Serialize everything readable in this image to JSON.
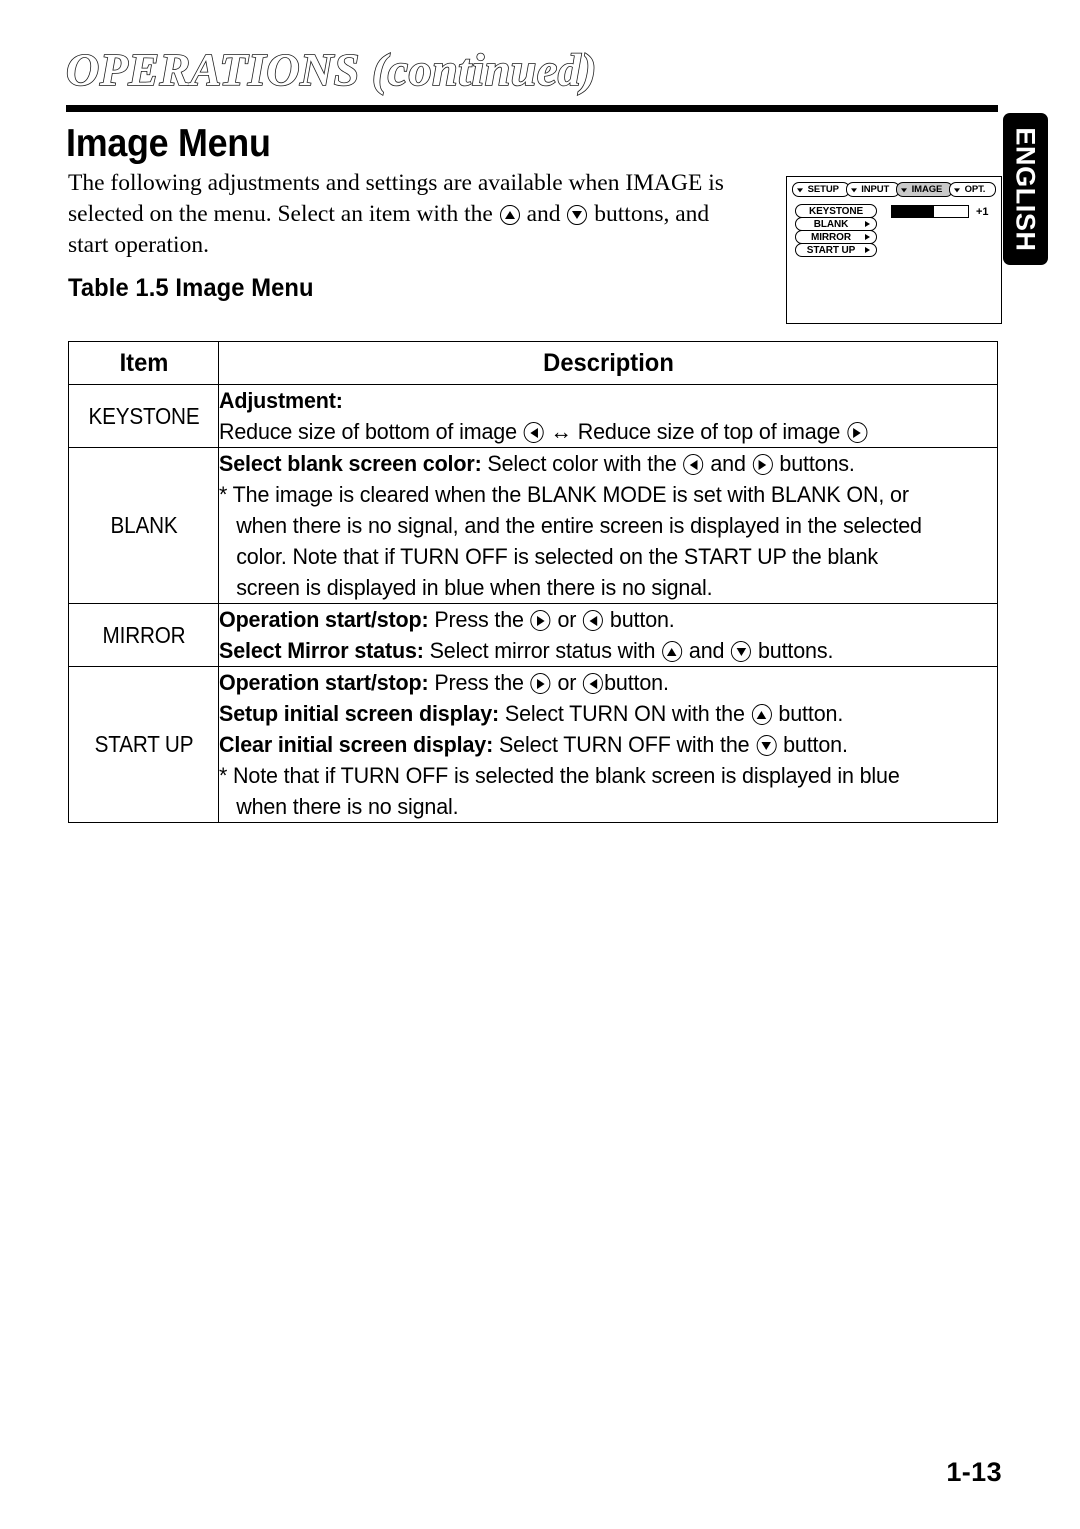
{
  "page": {
    "chapter_title": "OPERATIONS (continued)",
    "section_heading": "Image Menu",
    "page_number": "1-13",
    "language_tab": "ENGLISH"
  },
  "intro": {
    "line1": "The following adjustments and settings are available when IMAGE is",
    "line2a": "selected on the menu. Select an item with the",
    "line2b": "and",
    "line2c": "buttons, and",
    "line3": "start operation."
  },
  "table": {
    "caption": "Table 1.5 Image Menu",
    "headers": {
      "item": "Item",
      "description": "Description"
    },
    "rows": [
      {
        "item": "KEYSTONE",
        "lines": [
          {
            "bold": "Adjustment:"
          },
          {
            "text_a": "Reduce size of bottom of image",
            "icon_a": "left-arrow-button-icon",
            "mid": "↔",
            "text_b": "Reduce size of top of image",
            "icon_b": "right-arrow-button-icon"
          }
        ]
      },
      {
        "item": "BLANK",
        "lines": [
          {
            "bold": "Select blank screen color:",
            "text_a": "Select color with the",
            "icon_a": "left-arrow-button-icon",
            "mid": "and",
            "icon_b": "right-arrow-button-icon",
            "text_b": "buttons."
          },
          {
            "text": "* The image is cleared when the BLANK MODE is set with BLANK ON, or"
          },
          {
            "text": "when there is no signal, and the entire screen is displayed in the selected",
            "indent": true
          },
          {
            "text": "color. Note that if TURN OFF is selected on the START UP the blank",
            "indent": true
          },
          {
            "text": "screen is displayed in blue when there is no signal.",
            "indent": true
          }
        ]
      },
      {
        "item": "MIRROR",
        "lines": [
          {
            "bold": "Operation start/stop:",
            "text_a": "Press the",
            "icon_a": "right-arrow-button-icon",
            "mid": "or",
            "icon_b": "left-arrow-button-icon",
            "text_b": "button."
          },
          {
            "bold": "Select Mirror status:",
            "text_a": "Select mirror status with",
            "icon_a": "up-arrow-button-icon",
            "mid": "and",
            "icon_b": "down-arrow-button-icon",
            "text_b": "buttons."
          }
        ]
      },
      {
        "item": "START UP",
        "lines": [
          {
            "bold": "Operation start/stop:",
            "text_a": "Press the",
            "icon_a": "right-arrow-button-icon",
            "mid": "or",
            "icon_b": "left-arrow-button-icon",
            "text_b": "button."
          },
          {
            "bold": "Setup initial screen display:",
            "text_a": "Select TURN ON with the",
            "icon_a": "up-arrow-button-icon",
            "text_b": "button."
          },
          {
            "bold": "Clear initial screen display:",
            "text_a": "Select TURN OFF with the",
            "icon_a": "down-arrow-button-icon",
            "text_b": "button."
          },
          {
            "text": "* Note that if TURN OFF is selected the blank screen is displayed in blue"
          },
          {
            "text": "when there is no signal.",
            "indent": true
          }
        ]
      }
    ]
  },
  "osd": {
    "tabs": [
      {
        "label": "SETUP",
        "active": false
      },
      {
        "label": "INPUT",
        "active": false
      },
      {
        "label": "IMAGE",
        "active": true
      },
      {
        "label": "OPT.",
        "active": false
      }
    ],
    "items": [
      {
        "label": "KEYSTONE",
        "has_arrow": false,
        "selected": true
      },
      {
        "label": "BLANK",
        "has_arrow": true,
        "selected": false
      },
      {
        "label": "MIRROR",
        "has_arrow": true,
        "selected": false
      },
      {
        "label": "START UP",
        "has_arrow": true,
        "selected": false
      }
    ],
    "bar": {
      "value_label": "+1",
      "fill_percent": 55
    }
  },
  "colors": {
    "ink": "#000000",
    "paper": "#ffffff",
    "tab_highlight": "#c9c9c9"
  }
}
